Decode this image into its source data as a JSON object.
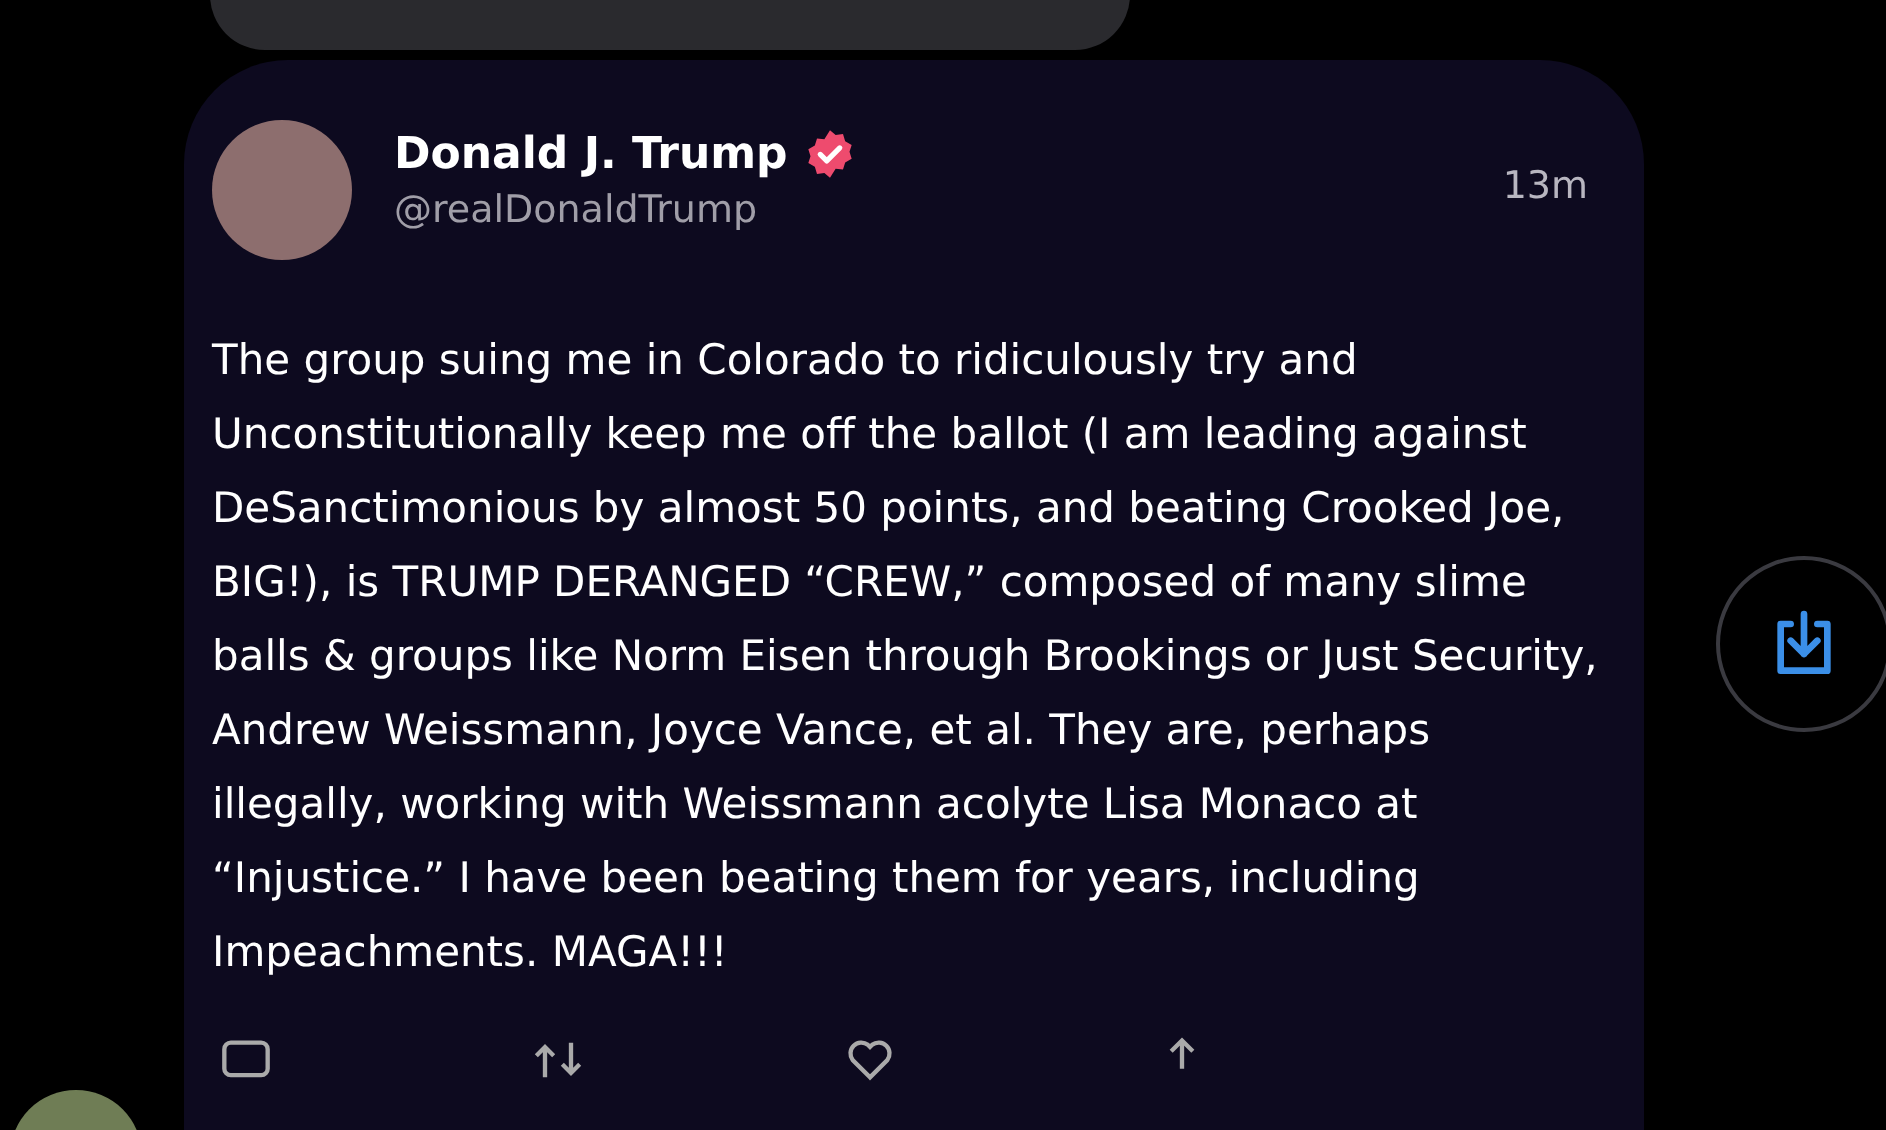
{
  "post": {
    "author": {
      "name": "Donald J. Trump",
      "verified": true,
      "handle": "@realDonaldTrump"
    },
    "time": "13m",
    "body": "The group suing me in Colorado to ridiculously try and Unconstitutionally keep me off the ballot (I am leading against DeSanctimonious by almost 50 points, and beating Crooked Joe, BIG!), is TRUMP DERANGED “CREW,” composed of many slime balls & groups like Norm Eisen through Brookings or Just Security, Andrew Weissmann, Joyce Vance, et al. They are, perhaps illegally, working with Weissmann acolyte Lisa Monaco at “Injustice.” I have been beating them for years, including Impeachments. MAGA!!!"
  }
}
